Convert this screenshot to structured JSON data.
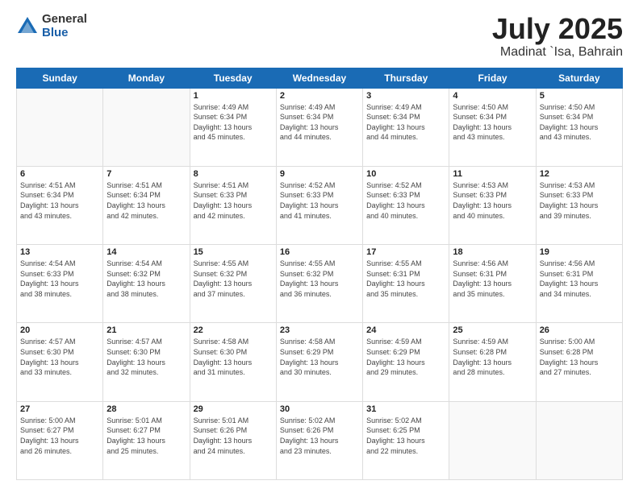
{
  "header": {
    "logo_general": "General",
    "logo_blue": "Blue",
    "title": "July 2025",
    "location": "Madinat `Isa, Bahrain"
  },
  "weekdays": [
    "Sunday",
    "Monday",
    "Tuesday",
    "Wednesday",
    "Thursday",
    "Friday",
    "Saturday"
  ],
  "weeks": [
    [
      {
        "day": "",
        "info": ""
      },
      {
        "day": "",
        "info": ""
      },
      {
        "day": "1",
        "info": "Sunrise: 4:49 AM\nSunset: 6:34 PM\nDaylight: 13 hours\nand 45 minutes."
      },
      {
        "day": "2",
        "info": "Sunrise: 4:49 AM\nSunset: 6:34 PM\nDaylight: 13 hours\nand 44 minutes."
      },
      {
        "day": "3",
        "info": "Sunrise: 4:49 AM\nSunset: 6:34 PM\nDaylight: 13 hours\nand 44 minutes."
      },
      {
        "day": "4",
        "info": "Sunrise: 4:50 AM\nSunset: 6:34 PM\nDaylight: 13 hours\nand 43 minutes."
      },
      {
        "day": "5",
        "info": "Sunrise: 4:50 AM\nSunset: 6:34 PM\nDaylight: 13 hours\nand 43 minutes."
      }
    ],
    [
      {
        "day": "6",
        "info": "Sunrise: 4:51 AM\nSunset: 6:34 PM\nDaylight: 13 hours\nand 43 minutes."
      },
      {
        "day": "7",
        "info": "Sunrise: 4:51 AM\nSunset: 6:34 PM\nDaylight: 13 hours\nand 42 minutes."
      },
      {
        "day": "8",
        "info": "Sunrise: 4:51 AM\nSunset: 6:33 PM\nDaylight: 13 hours\nand 42 minutes."
      },
      {
        "day": "9",
        "info": "Sunrise: 4:52 AM\nSunset: 6:33 PM\nDaylight: 13 hours\nand 41 minutes."
      },
      {
        "day": "10",
        "info": "Sunrise: 4:52 AM\nSunset: 6:33 PM\nDaylight: 13 hours\nand 40 minutes."
      },
      {
        "day": "11",
        "info": "Sunrise: 4:53 AM\nSunset: 6:33 PM\nDaylight: 13 hours\nand 40 minutes."
      },
      {
        "day": "12",
        "info": "Sunrise: 4:53 AM\nSunset: 6:33 PM\nDaylight: 13 hours\nand 39 minutes."
      }
    ],
    [
      {
        "day": "13",
        "info": "Sunrise: 4:54 AM\nSunset: 6:33 PM\nDaylight: 13 hours\nand 38 minutes."
      },
      {
        "day": "14",
        "info": "Sunrise: 4:54 AM\nSunset: 6:32 PM\nDaylight: 13 hours\nand 38 minutes."
      },
      {
        "day": "15",
        "info": "Sunrise: 4:55 AM\nSunset: 6:32 PM\nDaylight: 13 hours\nand 37 minutes."
      },
      {
        "day": "16",
        "info": "Sunrise: 4:55 AM\nSunset: 6:32 PM\nDaylight: 13 hours\nand 36 minutes."
      },
      {
        "day": "17",
        "info": "Sunrise: 4:55 AM\nSunset: 6:31 PM\nDaylight: 13 hours\nand 35 minutes."
      },
      {
        "day": "18",
        "info": "Sunrise: 4:56 AM\nSunset: 6:31 PM\nDaylight: 13 hours\nand 35 minutes."
      },
      {
        "day": "19",
        "info": "Sunrise: 4:56 AM\nSunset: 6:31 PM\nDaylight: 13 hours\nand 34 minutes."
      }
    ],
    [
      {
        "day": "20",
        "info": "Sunrise: 4:57 AM\nSunset: 6:30 PM\nDaylight: 13 hours\nand 33 minutes."
      },
      {
        "day": "21",
        "info": "Sunrise: 4:57 AM\nSunset: 6:30 PM\nDaylight: 13 hours\nand 32 minutes."
      },
      {
        "day": "22",
        "info": "Sunrise: 4:58 AM\nSunset: 6:30 PM\nDaylight: 13 hours\nand 31 minutes."
      },
      {
        "day": "23",
        "info": "Sunrise: 4:58 AM\nSunset: 6:29 PM\nDaylight: 13 hours\nand 30 minutes."
      },
      {
        "day": "24",
        "info": "Sunrise: 4:59 AM\nSunset: 6:29 PM\nDaylight: 13 hours\nand 29 minutes."
      },
      {
        "day": "25",
        "info": "Sunrise: 4:59 AM\nSunset: 6:28 PM\nDaylight: 13 hours\nand 28 minutes."
      },
      {
        "day": "26",
        "info": "Sunrise: 5:00 AM\nSunset: 6:28 PM\nDaylight: 13 hours\nand 27 minutes."
      }
    ],
    [
      {
        "day": "27",
        "info": "Sunrise: 5:00 AM\nSunset: 6:27 PM\nDaylight: 13 hours\nand 26 minutes."
      },
      {
        "day": "28",
        "info": "Sunrise: 5:01 AM\nSunset: 6:27 PM\nDaylight: 13 hours\nand 25 minutes."
      },
      {
        "day": "29",
        "info": "Sunrise: 5:01 AM\nSunset: 6:26 PM\nDaylight: 13 hours\nand 24 minutes."
      },
      {
        "day": "30",
        "info": "Sunrise: 5:02 AM\nSunset: 6:26 PM\nDaylight: 13 hours\nand 23 minutes."
      },
      {
        "day": "31",
        "info": "Sunrise: 5:02 AM\nSunset: 6:25 PM\nDaylight: 13 hours\nand 22 minutes."
      },
      {
        "day": "",
        "info": ""
      },
      {
        "day": "",
        "info": ""
      }
    ]
  ]
}
